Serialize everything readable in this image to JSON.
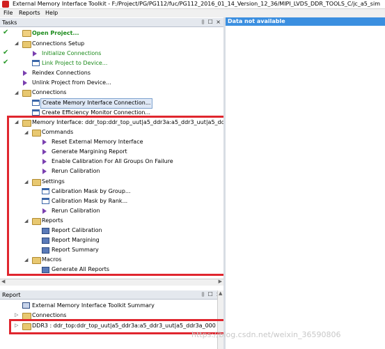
{
  "window": {
    "title": "External Memory Interface Toolkit - F:/Project/PG/PG112/fuc/PG112_2016_01_14_Version_12_36/MIPI_LVDS_DDR_TOOLS_C/jc_a5_sim"
  },
  "menu": [
    "File",
    "Reports",
    "Help"
  ],
  "tasks": {
    "header": "Tasks",
    "buttons": "⌷ ☐ ×",
    "items": [
      "Open Project...",
      "Connections Setup",
      "Initialize Connections",
      "Link Project to Device...",
      "Reindex Connections",
      "Unlink Project from Device...",
      "Connections",
      "Create Memory Interface Connection...",
      "Create Efficiency Monitor Connection...",
      "Memory Interface: ddr_top:ddr_top_uut|a5_ddr3a:a5_ddr3_uut|a5_ddr3a_0002",
      "Commands",
      "Reset External Memory Interface",
      "Generate Margining Report",
      "Enable Calibration For All Groups On Failure",
      "Rerun Calibration",
      "Settings",
      "Calibration Mask by Group...",
      "Calibration Mask by Rank...",
      "Rerun Calibration",
      "Reports",
      "Report Calibration",
      "Report Margining",
      "Report Summary",
      "Macros",
      "Generate All Reports"
    ]
  },
  "report": {
    "header": "Report",
    "buttons": "⌷ ☐ ×",
    "items": [
      "External Memory Interface Toolkit Summary",
      "Connections",
      "DDR3 : ddr_top:ddr_top_uut|a5_ddr3a:a5_ddr3_uut|a5_ddr3a_0002:a5_ddr3a_"
    ]
  },
  "right_panel": {
    "header": "Data not available"
  },
  "watermark": "https://blog.csdn.net/weixin_36590806",
  "colors": {
    "highlight_box": "#e0262e",
    "right_header": "#3b8fe0",
    "ok_check": "#2a9a2a"
  }
}
